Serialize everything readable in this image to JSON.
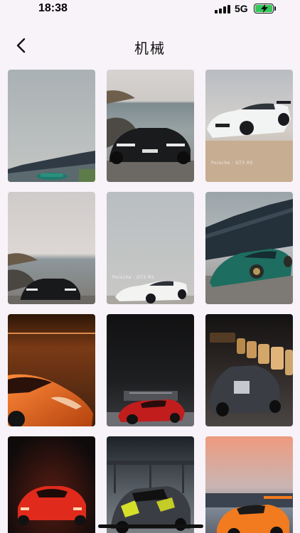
{
  "status_bar": {
    "time": "18:38",
    "network": "5G",
    "battery_color": "#34c759"
  },
  "header": {
    "title": "机械",
    "back_icon": "chevron-left-icon"
  },
  "gallery": {
    "captions": {
      "porsche_beach": "Porsche · GT3 RS",
      "porsche_gray": "Porsche · GT3 RS"
    }
  }
}
